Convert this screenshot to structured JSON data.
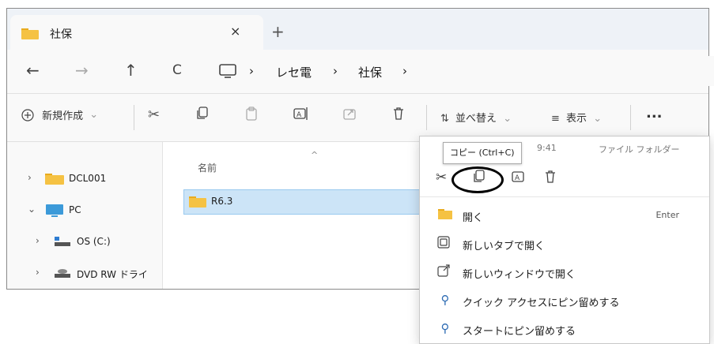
{
  "tab": {
    "title": "社保",
    "close": "×",
    "new": "+"
  },
  "nav": {
    "back": "←",
    "forward": "→",
    "up": "↑",
    "refresh": "C"
  },
  "address": {
    "sep": "›",
    "crumbs": [
      "レセ電",
      "社保"
    ]
  },
  "commandbar": {
    "new_label": "新規作成",
    "sort_label": "並べ替え",
    "view_label": "表示",
    "more": "..."
  },
  "tree": [
    {
      "chev": "›",
      "label": "DCL001"
    },
    {
      "chev": "⌄",
      "label": "PC"
    },
    {
      "chev": "›",
      "label": "OS (C:)"
    },
    {
      "chev": "›",
      "label": "DVD RW ドライ"
    }
  ],
  "list": {
    "column_name": "名前",
    "sort_arrow": "^",
    "items": [
      "R6.3"
    ]
  },
  "context_menu": {
    "header_time": "9:41",
    "header_type": "ファイル フォルダー",
    "tooltip": "コピー (Ctrl+C)",
    "items": [
      {
        "label": "開く",
        "shortcut": "Enter"
      },
      {
        "label": "新しいタブで開く"
      },
      {
        "label": "新しいウィンドウで開く"
      },
      {
        "label": "クイック アクセスにピン留めする"
      },
      {
        "label": "スタートにピン留めする"
      }
    ]
  },
  "colors": {
    "folder": "#f5c243",
    "selection": "#cce4f7",
    "accent": "#2d6bb3"
  }
}
